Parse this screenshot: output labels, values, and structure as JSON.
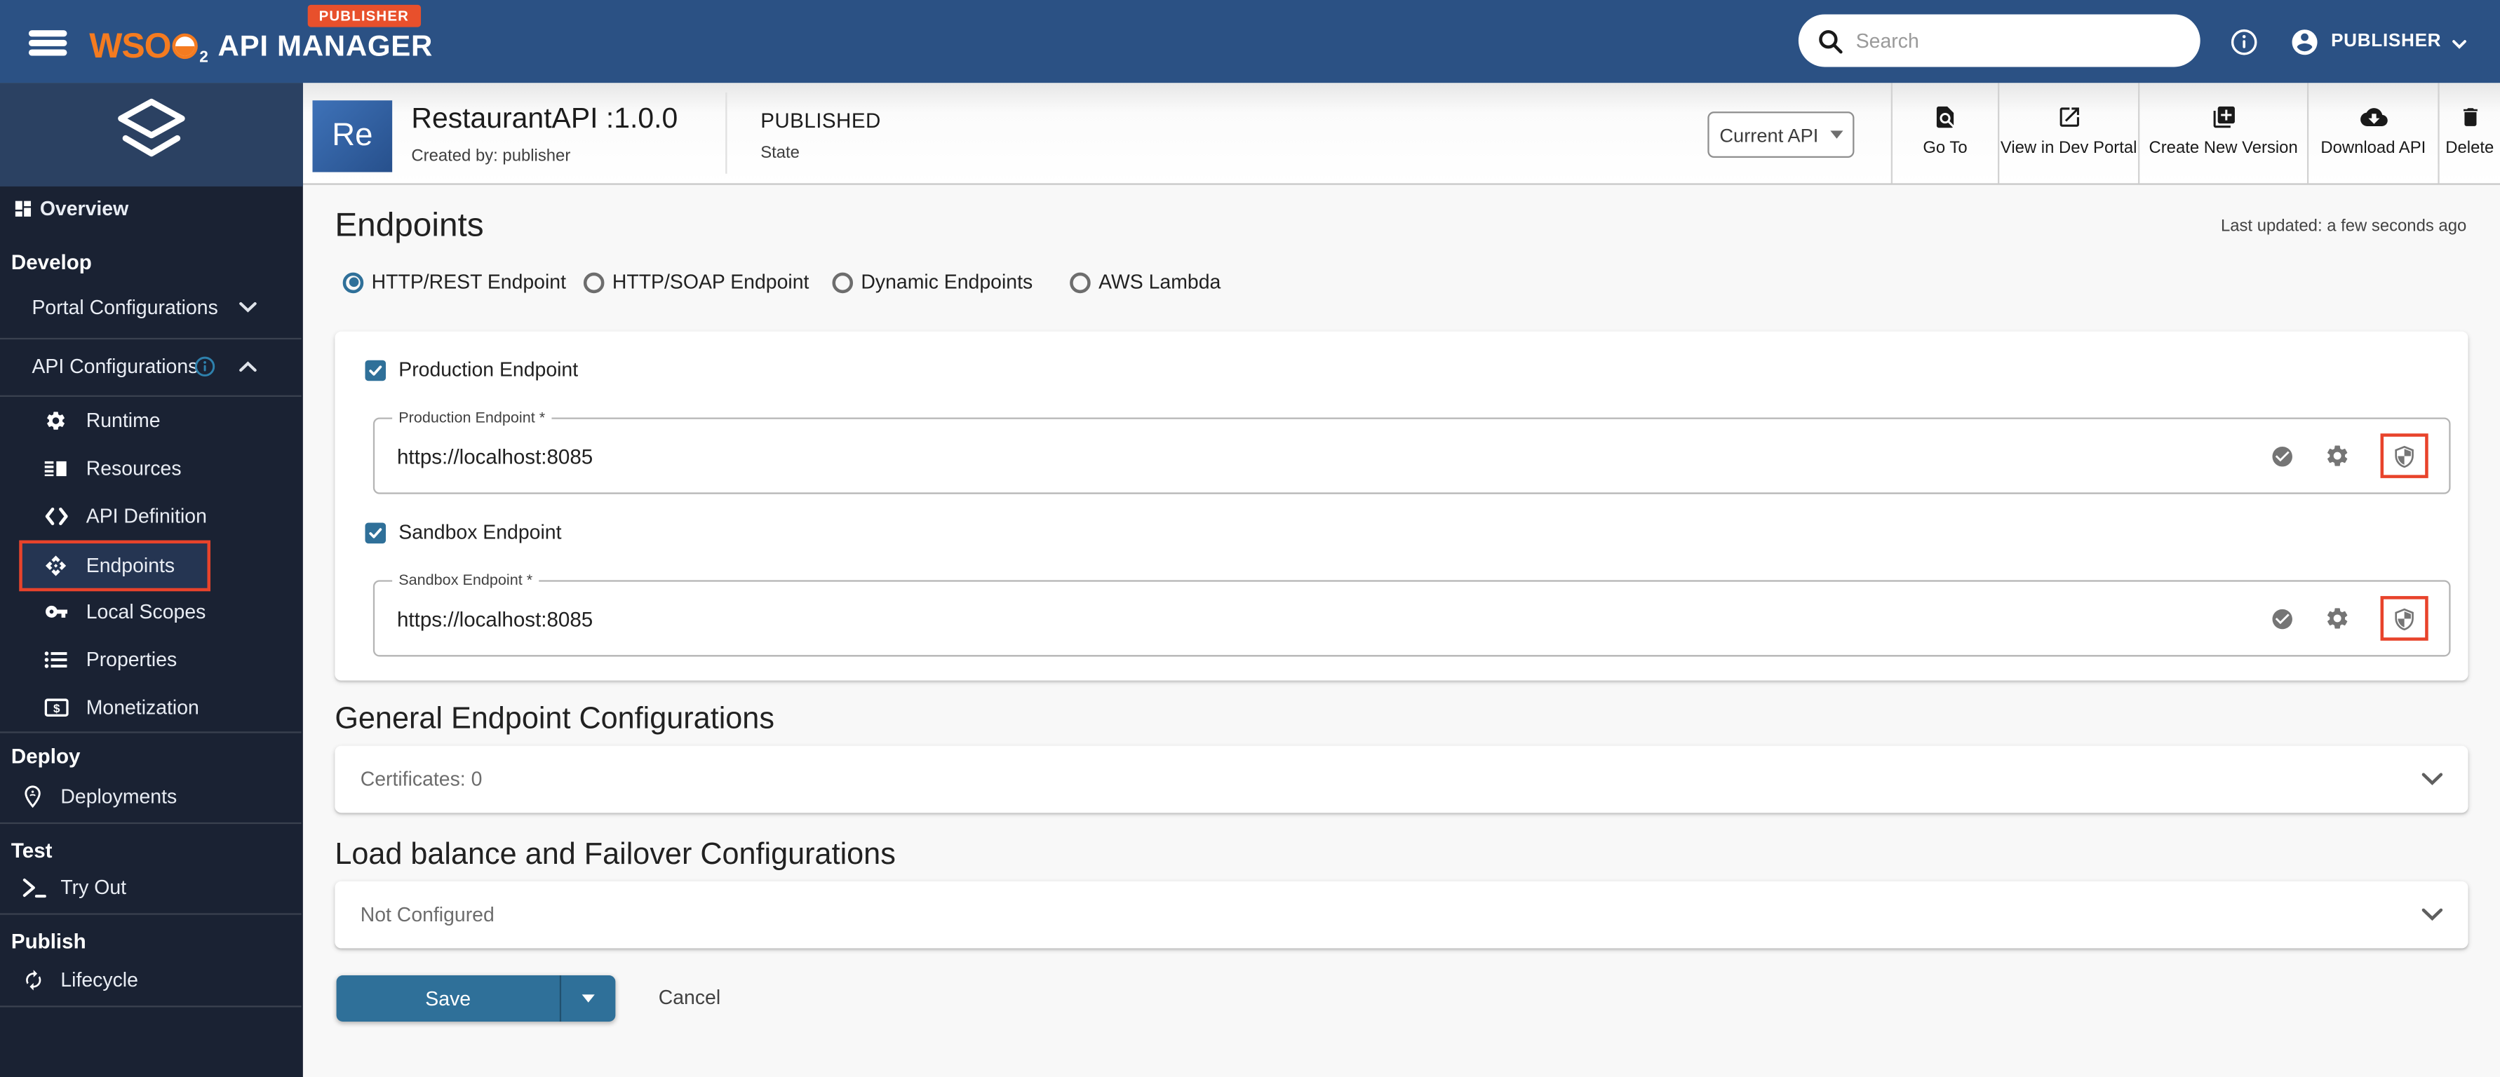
{
  "header": {
    "brand": {
      "wso": "WSO",
      "sub": "2",
      "product": "API MANAGER",
      "badge": "PUBLISHER"
    },
    "search_placeholder": "Search",
    "account_label": "PUBLISHER"
  },
  "api_bar": {
    "avatar": "Re",
    "title": "RestaurantAPI :1.0.0",
    "created_by": "Created by: publisher",
    "state_value": "PUBLISHED",
    "state_caption": "State",
    "version_selector": "Current API",
    "actions": [
      {
        "label": "Go To",
        "icon": "document-search-icon"
      },
      {
        "label": "View in Dev Portal",
        "icon": "open-in-new-icon"
      },
      {
        "label": "Create New Version",
        "icon": "copy-add-icon"
      },
      {
        "label": "Download API",
        "icon": "cloud-download-icon"
      },
      {
        "label": "Delete",
        "icon": "trash-icon"
      }
    ]
  },
  "sidebar": {
    "overview": {
      "label": "Overview",
      "icon": "dashboard-icon"
    },
    "develop_header": "Develop",
    "portal_configurations": {
      "label": "Portal Configurations",
      "icon": "chevron-down-icon"
    },
    "api_configurations": {
      "label": "API Configurations",
      "icons": [
        "info-icon",
        "chevron-up-icon"
      ]
    },
    "api_config_items": [
      {
        "label": "Runtime",
        "icon": "gear-icon"
      },
      {
        "label": "Resources",
        "icon": "resources-icon"
      },
      {
        "label": "API Definition",
        "icon": "code-icon"
      },
      {
        "label": "Endpoints",
        "icon": "endpoints-icon",
        "selected": true
      },
      {
        "label": "Local Scopes",
        "icon": "key-icon"
      },
      {
        "label": "Properties",
        "icon": "bullet-list-icon"
      },
      {
        "label": "Monetization",
        "icon": "money-icon"
      }
    ],
    "deploy_header": "Deploy",
    "deployments": {
      "label": "Deployments",
      "icon": "location-pin-icon"
    },
    "test_header": "Test",
    "try_out": {
      "label": "Try Out",
      "icon": "terminal-icon"
    },
    "publish_header": "Publish",
    "lifecycle": {
      "label": "Lifecycle",
      "icon": "lifecycle-icon"
    }
  },
  "main": {
    "page_title": "Endpoints",
    "last_updated": "Last updated: a few seconds ago",
    "endpoint_types": [
      {
        "label": "HTTP/REST Endpoint",
        "selected": true
      },
      {
        "label": "HTTP/SOAP Endpoint",
        "selected": false
      },
      {
        "label": "Dynamic Endpoints",
        "selected": false
      },
      {
        "label": "AWS Lambda",
        "selected": false
      }
    ],
    "production": {
      "checkbox": "Production Endpoint",
      "field_label": "Production Endpoint *",
      "value": "https://localhost:8085"
    },
    "sandbox": {
      "checkbox": "Sandbox Endpoint",
      "field_label": "Sandbox Endpoint *",
      "value": "https://localhost:8085"
    },
    "general_heading": "General Endpoint Configurations",
    "certificates": {
      "summary": "Certificates: 0"
    },
    "loadbalance_heading": "Load balance and Failover Configurations",
    "loadbalance": {
      "summary": "Not Configured"
    },
    "save": "Save",
    "cancel": "Cancel"
  },
  "colors": {
    "header_blue": "#2b5184",
    "sidebar_dark": "#1a2233",
    "sidebar_top": "#2b4162",
    "accent_blue": "#2f7099",
    "badge_orange": "#e8502c",
    "annotation_red": "#e8432b",
    "logo_orange": "#f47b20"
  }
}
